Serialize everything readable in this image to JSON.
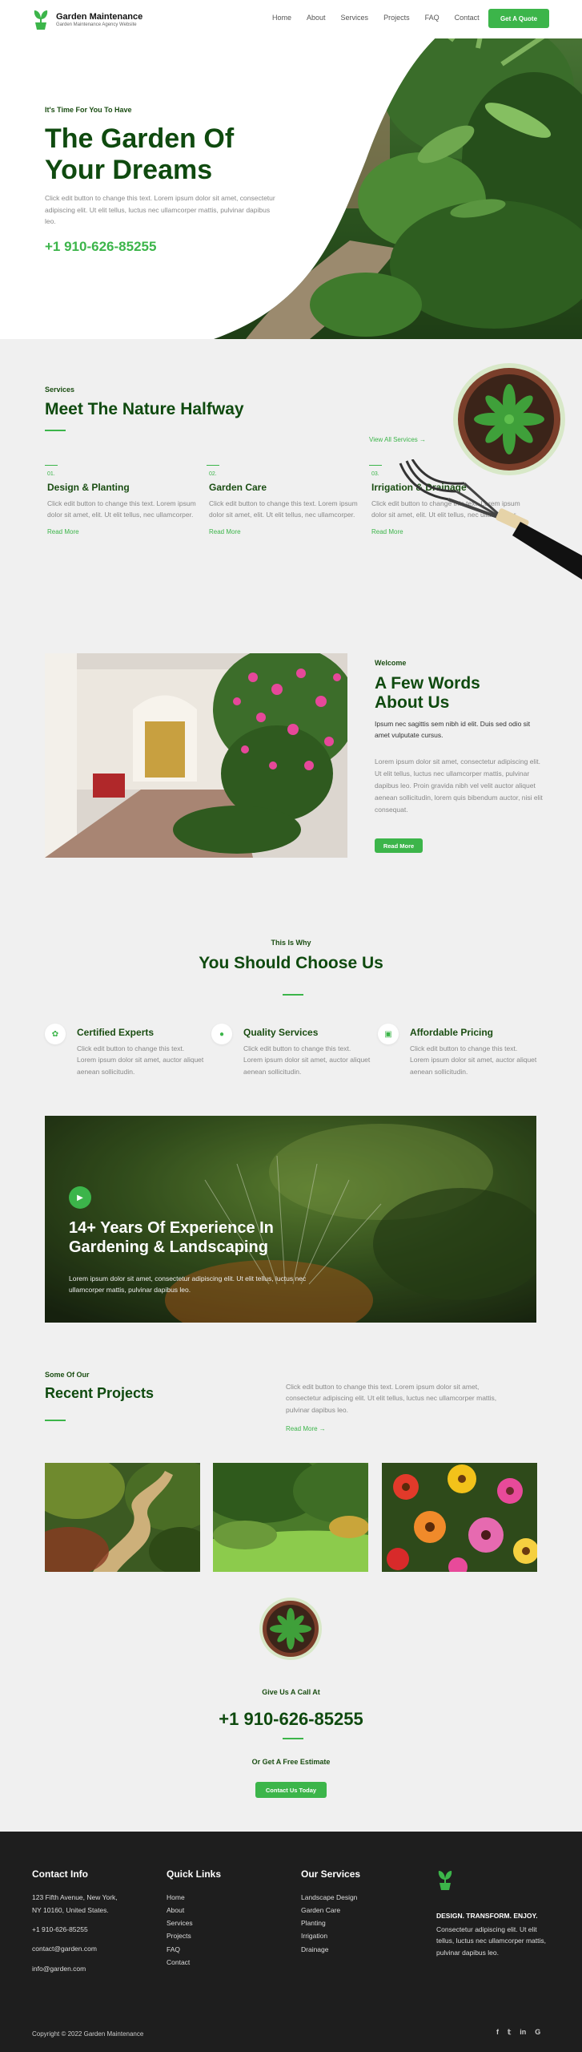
{
  "brand": {
    "name": "Garden Maintenance",
    "tagline": "Garden Maintenance Agency Website",
    "accent_color": "#3cb54a",
    "heading_color": "#0f4a0f",
    "logo_icon": "plant-logo-icon"
  },
  "nav": {
    "items": [
      "Home",
      "About",
      "Services",
      "Projects",
      "FAQ",
      "Contact"
    ],
    "cta": "Get A Quote"
  },
  "hero": {
    "kicker": "It's Time For You To Have",
    "title_line1": "The Garden Of",
    "title_line2": "Your Dreams",
    "description": "Click edit button to change this text. Lorem ipsum dolor sit amet, consectetur adipiscing elit. Ut elit tellus, luctus nec ullamcorper mattis, pulvinar dapibus leo.",
    "phone": "+1 910-626-85255"
  },
  "services": {
    "kicker": "Services",
    "title": "Meet The Nature Halfway",
    "view_all": "View All Services →",
    "items": [
      {
        "num": "01.",
        "title": "Design & Planting",
        "desc": "Click edit button to change this text. Lorem ipsum dolor sit amet, elit. Ut elit tellus, nec ullamcorper.",
        "link": "Read More"
      },
      {
        "num": "02.",
        "title": "Garden Care",
        "desc": "Click edit button to change this text. Lorem ipsum dolor sit amet, elit. Ut elit tellus, nec ullamcorper.",
        "link": "Read More"
      },
      {
        "num": "03.",
        "title": "Irrigation & Drainage",
        "desc": "Click edit button to change this text. Lorem ipsum dolor sit amet, elit. Ut elit tellus, nec ullamcorper.",
        "link": "Read More"
      }
    ]
  },
  "about": {
    "kicker": "Welcome",
    "title_line1": "A Few Words",
    "title_line2": "About Us",
    "lead": "Ipsum nec sagittis sem nibh id elit. Duis sed odio sit amet vulputate cursus.",
    "body": "Lorem ipsum dolor sit amet, consectetur adipiscing elit. Ut elit tellus, luctus nec ullamcorper mattis, pulvinar dapibus leo. Proin gravida nibh vel velit auctor aliquet aenean sollicitudin, lorem quis bibendum auctor, nisi elit consequat.",
    "button": "Read More"
  },
  "why": {
    "kicker": "This Is Why",
    "title": "You Should Choose Us",
    "features": [
      {
        "icon": "leaf-icon",
        "title": "Certified Experts",
        "desc": "Click edit button to change this text. Lorem ipsum dolor sit amet, auctor aliquet aenean sollicitudin."
      },
      {
        "icon": "circle-icon",
        "title": "Quality Services",
        "desc": "Click edit button to change this text. Lorem ipsum dolor sit amet, auctor aliquet aenean sollicitudin."
      },
      {
        "icon": "tag-icon",
        "title": "Affordable Pricing",
        "desc": "Click edit button to change this text. Lorem ipsum dolor sit amet, auctor aliquet aenean sollicitudin."
      }
    ]
  },
  "experience": {
    "title_line1": "14+ Years Of Experience In",
    "title_line2": "Gardening & Landscaping",
    "desc": "Lorem ipsum dolor sit amet, consectetur adipiscing elit. Ut elit tellus, luctus nec ullamcorper mattis, pulvinar dapibus leo."
  },
  "projects": {
    "kicker": "Some Of Our",
    "title": "Recent Projects",
    "desc": "Click edit button to change this text. Lorem ipsum dolor sit amet, consectetur adipiscing elit. Ut elit tellus, luctus nec ullamcorper mattis, pulvinar dapibus leo.",
    "link": "Read More →"
  },
  "call": {
    "kicker": "Give Us A Call At",
    "phone": "+1 910-626-85255",
    "sub": "Or Get A Free Estimate",
    "button": "Contact Us Today"
  },
  "footer": {
    "contact_title": "Contact Info",
    "address_line1": "123 Fifth Avenue, New York,",
    "address_line2": "NY 10160, United States.",
    "phone": "+1 910-626-85255",
    "email1": "contact@garden.com",
    "email2": "info@garden.com",
    "links_title": "Quick Links",
    "links": [
      "Home",
      "About",
      "Services",
      "Projects",
      "FAQ",
      "Contact"
    ],
    "services_title": "Our Services",
    "services": [
      "Landscape Design",
      "Garden Care",
      "Planting",
      "Irrigation",
      "Drainage"
    ],
    "tagline": "DESIGN. TRANSFORM. ENJOY.",
    "about": "Consectetur adipiscing elit. Ut elit tellus, luctus nec ullamcorper mattis, pulvinar dapibus leo.",
    "copyright": "Copyright © 2022 Garden Maintenance",
    "social": [
      "facebook-icon",
      "twitter-icon",
      "linkedin-icon",
      "google-icon"
    ]
  }
}
